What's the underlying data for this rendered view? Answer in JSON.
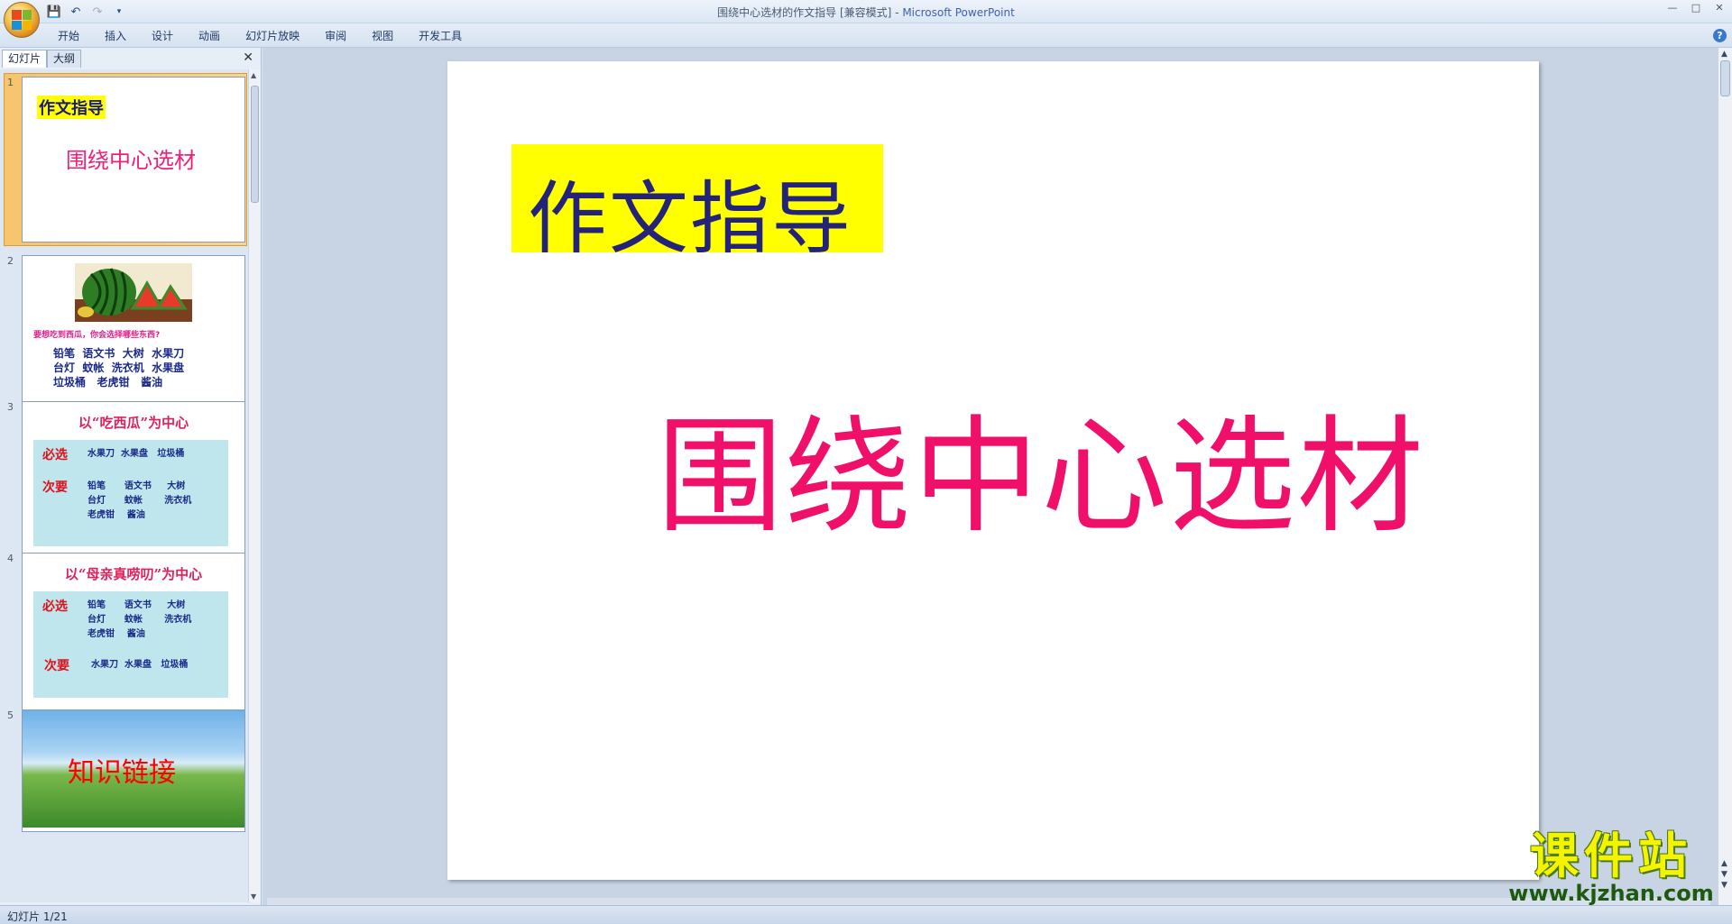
{
  "window": {
    "title": "围绕中心选材的作文指导 [兼容模式]",
    "separator": " - ",
    "app_name": "Microsoft PowerPoint"
  },
  "ribbon": {
    "tabs": [
      "开始",
      "插入",
      "设计",
      "动画",
      "幻灯片放映",
      "审阅",
      "视图",
      "开发工具"
    ]
  },
  "left_pane": {
    "tabs": [
      "幻灯片",
      "大纲"
    ],
    "slides": [
      {
        "num": "1",
        "title": "作文指导",
        "subtitle": "围绕中心选材"
      },
      {
        "num": "2",
        "question": "要想吃到西瓜，你会选择哪些东西?",
        "words": "铅笔  语文书  大树  水果刀\n台灯  蚊帐  洗衣机  水果盘\n垃圾桶   老虎钳   酱油"
      },
      {
        "num": "3",
        "title": "以“吃西瓜”为中心",
        "must_label": "必选",
        "must_items": "水果刀  水果盘   垃圾桶",
        "second_label": "次要",
        "second_items": "铅笔      语文书     大树\n台灯      蚊帐       洗衣机\n老虎钳    酱油"
      },
      {
        "num": "4",
        "title": "以“母亲真唠叨”为中心",
        "must_label": "必选",
        "must_items": "铅笔      语文书     大树\n台灯      蚊帐       洗衣机\n老虎钳    酱油",
        "second_label": "次要",
        "second_items": "水果刀  水果盘   垃圾桶"
      },
      {
        "num": "5",
        "title": "知识链接"
      }
    ]
  },
  "slide": {
    "title": "作文指导",
    "subtitle": "围绕中心选材"
  },
  "status": {
    "text": "幻灯片 1/21"
  },
  "watermark": {
    "big": "课件站",
    "url": "www.kjzhan.com"
  },
  "colors": {
    "title_bg": "#ffff00",
    "title_text": "#23237a",
    "subtitle_text": "#f0106a"
  }
}
